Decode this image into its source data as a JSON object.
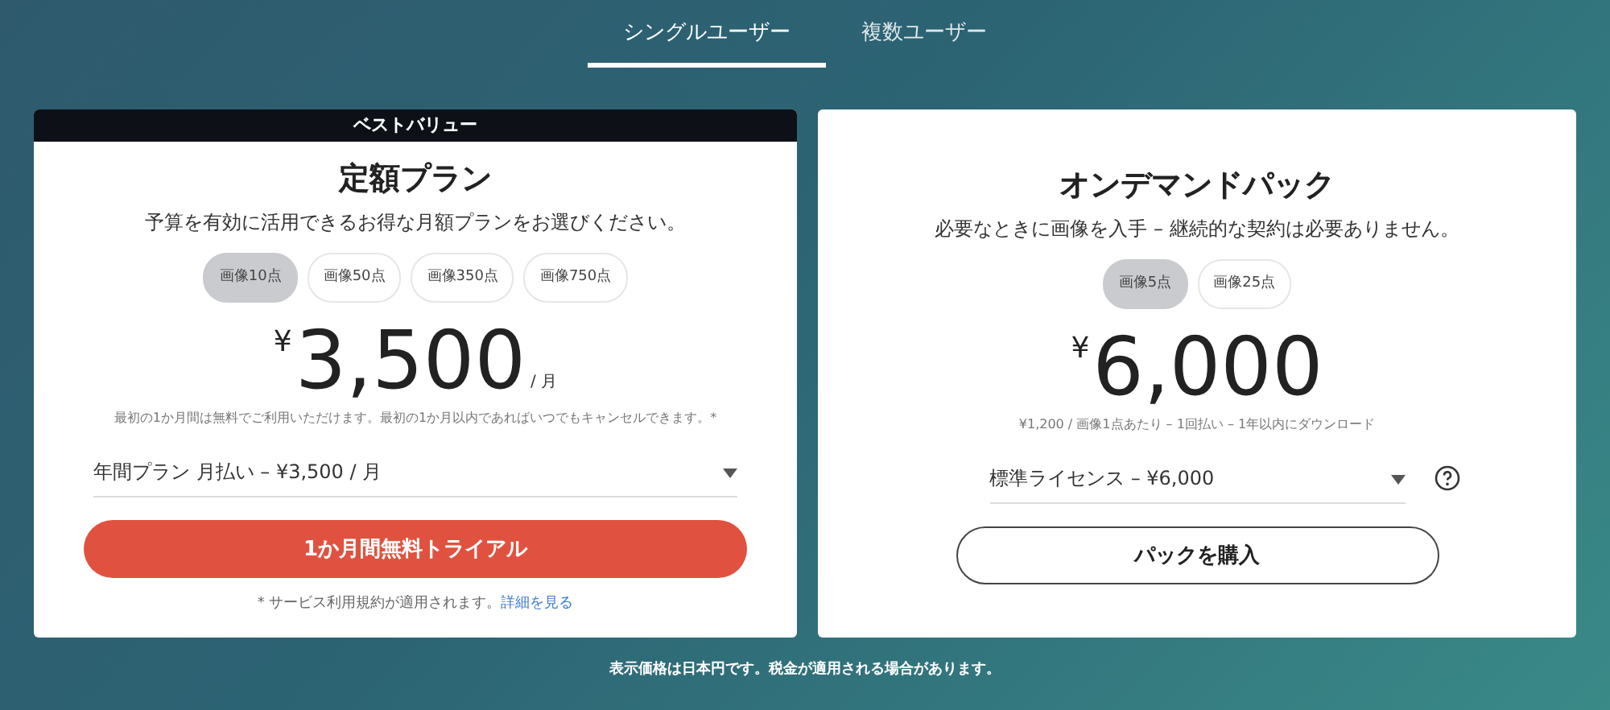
{
  "tabs": [
    {
      "label": "シングルユーザー",
      "selected": true
    },
    {
      "label": "複数ユーザー",
      "selected": false
    }
  ],
  "plans": [
    {
      "banner": "ベストバリュー",
      "title": "定額プラン",
      "subtitle": "予算を有効に活用できるお得な月額プランをお選びください。",
      "options": [
        {
          "label": "画像10点",
          "selected": true
        },
        {
          "label": "画像50点",
          "selected": false
        },
        {
          "label": "画像350点",
          "selected": false
        },
        {
          "label": "画像750点",
          "selected": false
        }
      ],
      "currency": "¥",
      "amount": "3,500",
      "period": "/ 月",
      "note": "最初の1か月間は無料でご利用いただけます。最初の1か月以内であればいつでもキャンセルできます。*",
      "dropdown": "年間プラン 月払い – ¥3,500 / 月",
      "help": false,
      "button": {
        "label": "1か月間無料トライアル",
        "kind": "trial"
      },
      "terms": {
        "text": "* サービス利用規約が適用されます。",
        "link": "詳細を見る"
      }
    },
    {
      "title": "オンデマンドパック",
      "subtitle": "必要なときに画像を入手 – 継続的な契約は必要ありません。",
      "options": [
        {
          "label": "画像5点",
          "selected": true
        },
        {
          "label": "画像25点",
          "selected": false
        }
      ],
      "currency": "¥",
      "amount": "6,000",
      "note": "¥1,200 / 画像1点あたり – 1回払い – 1年以内にダウンロード",
      "dropdown": "標準ライセンス – ¥6,000",
      "help": true,
      "button": {
        "label": "パックを購入",
        "kind": "buy"
      }
    }
  ],
  "footer": "表示価格は日本円です。税金が適用される場合があります。"
}
